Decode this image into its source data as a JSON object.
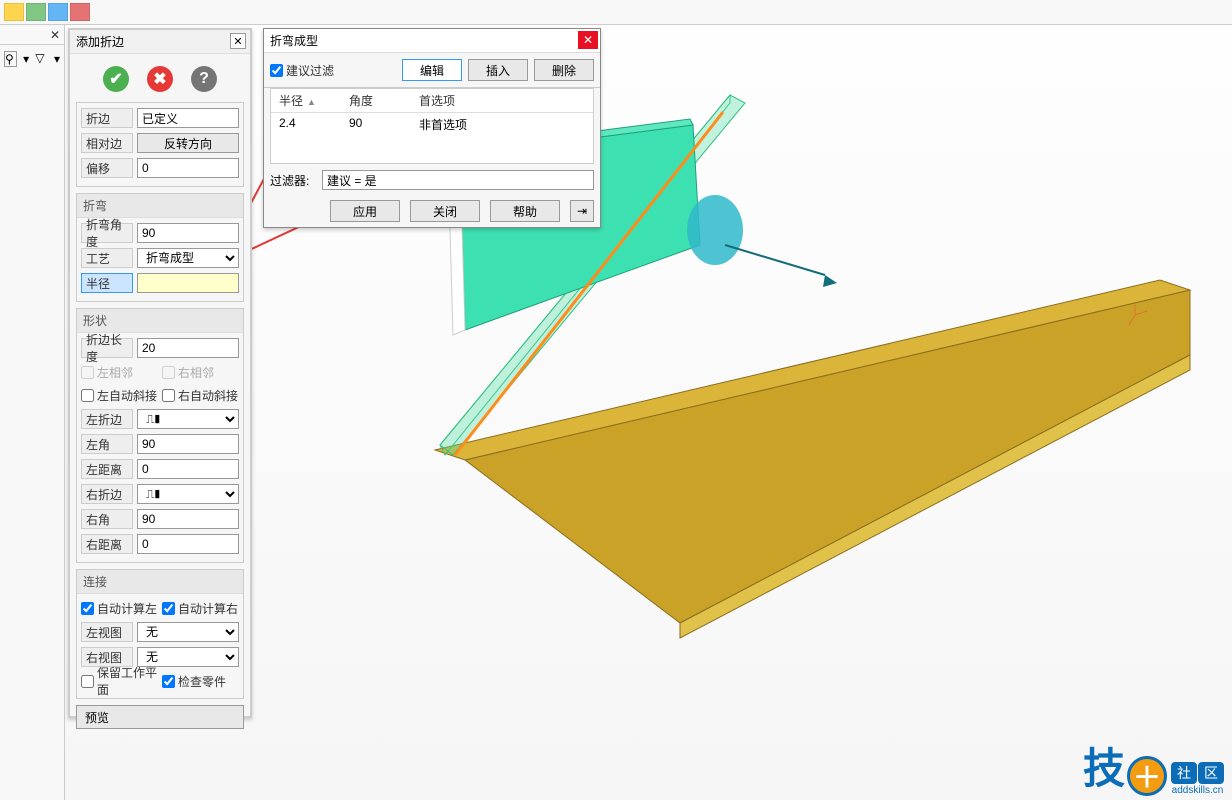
{
  "panel_add": {
    "title": "添加折边",
    "fold": {
      "label": "折边",
      "value": "已定义"
    },
    "opposite": {
      "label": "相对边",
      "btn": "反转方向"
    },
    "offset": {
      "label": "偏移",
      "value": "0"
    },
    "sec_bend": "折弯",
    "bend_angle": {
      "label": "折弯角度",
      "value": "90"
    },
    "process": {
      "label": "工艺",
      "value": "折弯成型"
    },
    "radius": {
      "label": "半径",
      "value": ""
    },
    "sec_shape": "形状",
    "fold_len": {
      "label": "折边长度",
      "value": "20"
    },
    "left_adj": "左相邻",
    "right_adj": "右相邻",
    "left_auto": "左自动斜接",
    "right_auto": "右自动斜接",
    "left_fold": {
      "label": "左折边",
      "value": ""
    },
    "left_ang": {
      "label": "左角",
      "value": "90"
    },
    "left_dist": {
      "label": "左距离",
      "value": "0"
    },
    "right_fold": {
      "label": "右折边",
      "value": ""
    },
    "right_ang": {
      "label": "右角",
      "value": "90"
    },
    "right_dist": {
      "label": "右距离",
      "value": "0"
    },
    "sec_conn": "连接",
    "auto_left": "自动计算左",
    "auto_right": "自动计算右",
    "left_view": {
      "label": "左视图",
      "value": "无"
    },
    "right_view": {
      "label": "右视图",
      "value": "无"
    },
    "keep_wp": "保留工作平面",
    "check_part": "检查零件",
    "preview": "预览"
  },
  "panel_bend": {
    "title": "折弯成型",
    "suggest_filter": "建议过滤",
    "btn_edit": "编辑",
    "btn_insert": "插入",
    "btn_delete": "删除",
    "col_radius": "半径",
    "col_angle": "角度",
    "col_pref": "首选项",
    "row": {
      "radius": "2.4",
      "angle": "90",
      "pref": "非首选项"
    },
    "filter_label": "过滤器:",
    "filter_value": "建议 = 是",
    "btn_apply": "应用",
    "btn_close": "关闭",
    "btn_help": "帮助"
  },
  "logo": {
    "text": "技",
    "s1": "社",
    "s2": "区",
    "url": "addskills.cn"
  }
}
